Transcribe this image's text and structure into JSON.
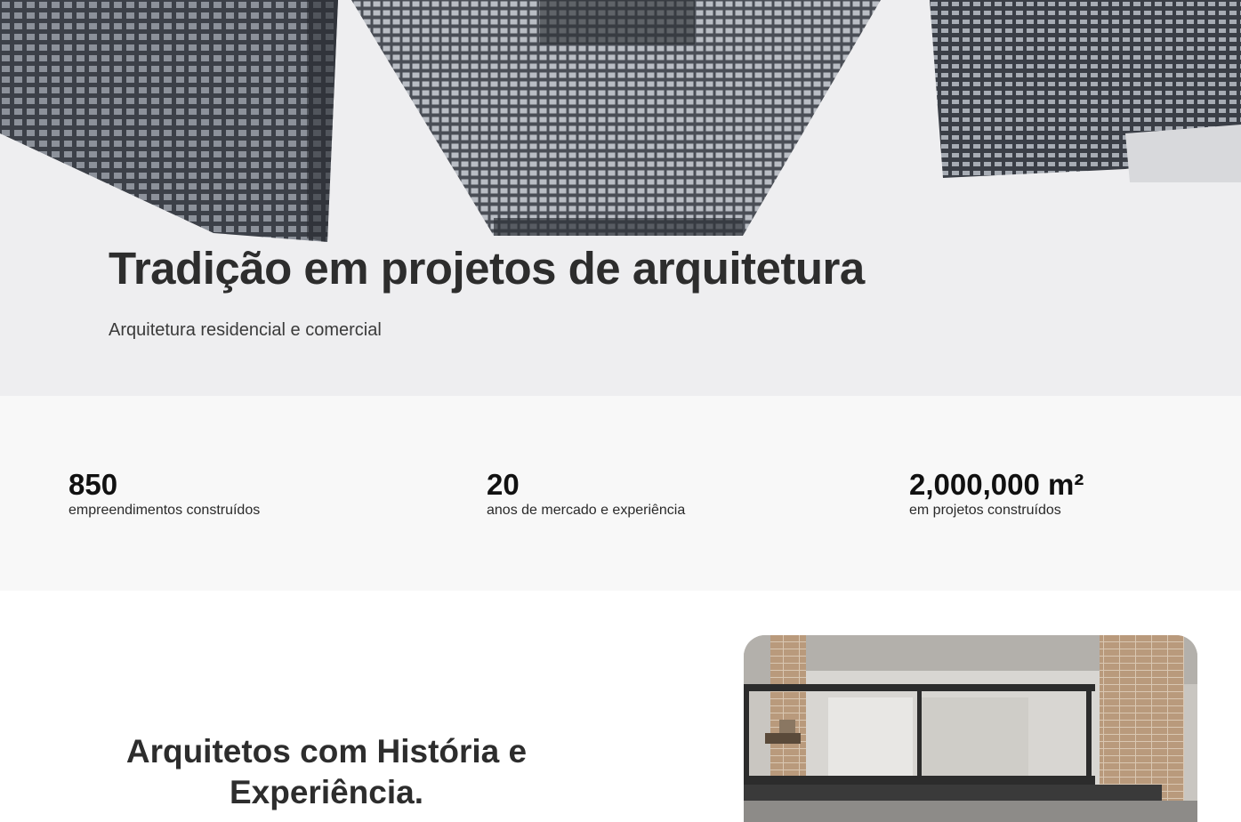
{
  "hero": {
    "title": "Tradição em projetos de arquitetura",
    "subtitle": "Arquitetura residencial e comercial"
  },
  "stats": [
    {
      "value": "850",
      "label": "empreendimentos construídos"
    },
    {
      "value": "20",
      "label": "anos de mercado e experiência"
    },
    {
      "value": "2,000,000 m²",
      "label": "em projetos construídos"
    }
  ],
  "about": {
    "title_line1": "Arquitetos com História e",
    "title_line2": "Experiência."
  },
  "colors": {
    "hero_sky": "#eeeef0",
    "stats_background": "#f8f8f8",
    "heading_text": "#2d2d2d"
  }
}
